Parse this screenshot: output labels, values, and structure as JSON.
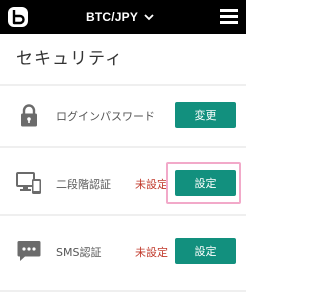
{
  "header": {
    "pair": "BTC/JPY",
    "logo_icon": "bitbank-logo-icon",
    "dropdown_icon": "chevron-down-icon",
    "menu_icon": "hamburger-menu-icon"
  },
  "page": {
    "title": "セキュリティ"
  },
  "rows": [
    {
      "icon": "lock-icon",
      "label": "ログインパスワード",
      "status": "",
      "button": "変更"
    },
    {
      "icon": "monitor-phone-icon",
      "label": "二段階認証",
      "status": "未設定",
      "button": "設定"
    },
    {
      "icon": "sms-chat-icon",
      "label": "SMS認証",
      "status": "未設定",
      "button": "設定"
    }
  ],
  "colors": {
    "header_bg": "#000000",
    "button_bg": "#12907e",
    "status_text": "#c0392b",
    "highlight_border": "#f2a9c9"
  }
}
